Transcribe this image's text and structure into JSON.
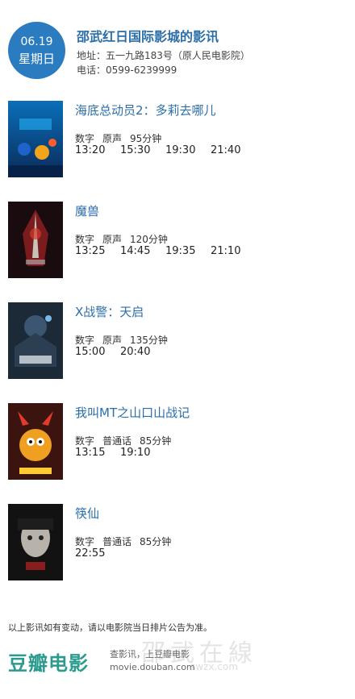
{
  "header": {
    "date": "06.19",
    "weekday": "星期日",
    "cinema_name": "邵武红日国际影城的影讯",
    "address": "地址：五一九路183号（原人民电影院）",
    "phone": "电话：0599-6239999"
  },
  "movies": [
    {
      "title": "海底总动员2：多莉去哪儿",
      "format": "数字",
      "language": "原声",
      "duration": "95分钟",
      "times": [
        "13:20",
        "15:30",
        "19:30",
        "21:40"
      ]
    },
    {
      "title": "魔兽",
      "format": "数字",
      "language": "原声",
      "duration": "120分钟",
      "times": [
        "13:25",
        "14:45",
        "19:35",
        "21:10"
      ]
    },
    {
      "title": "X战警：天启",
      "format": "数字",
      "language": "原声",
      "duration": "135分钟",
      "times": [
        "15:00",
        "20:40"
      ]
    },
    {
      "title": "我叫MT之山口山战记",
      "format": "数字",
      "language": "普通话",
      "duration": "85分钟",
      "times": [
        "13:15",
        "19:10"
      ]
    },
    {
      "title": "筷仙",
      "format": "数字",
      "language": "普通话",
      "duration": "85分钟",
      "times": [
        "22:55"
      ]
    }
  ],
  "footer": {
    "notice": "以上影讯如有变动，请以电影院当日排片公告为准。",
    "brand": "豆瓣电影",
    "brand_tagline": "查影讯，上豆瓣电影",
    "brand_url": "movie.douban.com",
    "watermark": "邵武在線",
    "watermark_url": "swzx.com"
  },
  "colors": {
    "accent": "#2b7bc0",
    "title": "#2b6ea8",
    "brand": "#2b9b8f"
  }
}
